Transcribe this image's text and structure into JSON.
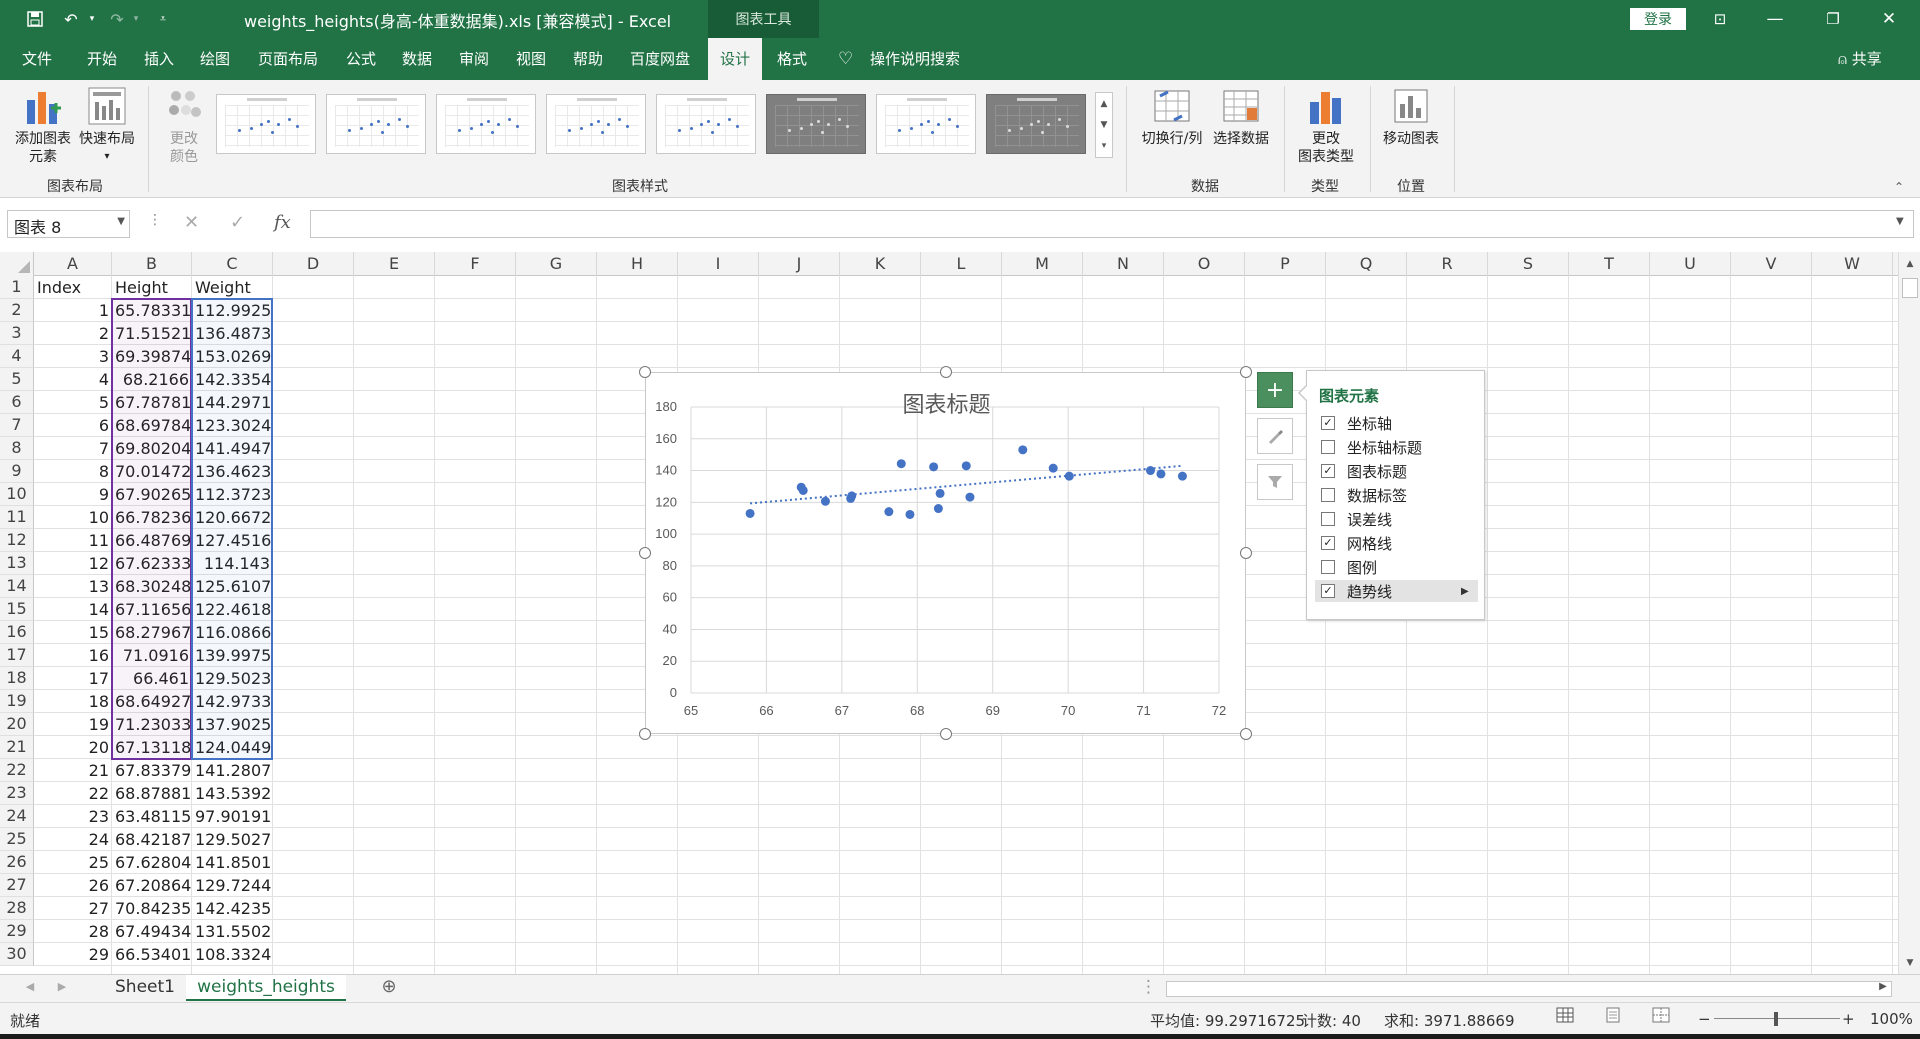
{
  "titlebar": {
    "doc_title": "weights_heights(身高-体重数据集).xls  [兼容模式]  -  Excel",
    "chart_tools": "图表工具",
    "login": "登录"
  },
  "menu": {
    "items": [
      "文件",
      "开始",
      "插入",
      "绘图",
      "页面布局",
      "公式",
      "数据",
      "审阅",
      "视图",
      "帮助",
      "百度网盘",
      "设计",
      "格式"
    ],
    "active": "设计",
    "search": "操作说明搜索",
    "share": "共享"
  },
  "ribbon": {
    "add_element": "添加图表",
    "add_element_2": "元素",
    "quick_layout": "快速布局",
    "change_color": "更改",
    "change_color_2": "颜色",
    "group_layout": "图表布局",
    "group_styles": "图表样式",
    "switch_rowcol": "切换行/列",
    "select_data": "选择数据",
    "group_data": "数据",
    "change_type": "更改",
    "change_type_2": "图表类型",
    "group_type": "类型",
    "move_chart": "移动图表",
    "group_location": "位置"
  },
  "formula_bar": {
    "name_box": "图表 8",
    "fx": "fx",
    "value": ""
  },
  "columns": [
    "A",
    "B",
    "C",
    "D",
    "E",
    "F",
    "G",
    "H",
    "I",
    "J",
    "K",
    "L",
    "M",
    "N",
    "O",
    "P",
    "Q",
    "R",
    "S",
    "T",
    "U",
    "V",
    "W"
  ],
  "headers": [
    "Index",
    "Height",
    "Weight"
  ],
  "rows": [
    [
      1,
      "65.78331",
      "112.9925"
    ],
    [
      2,
      "71.51521",
      "136.4873"
    ],
    [
      3,
      "69.39874",
      "153.0269"
    ],
    [
      4,
      "68.2166",
      "142.3354"
    ],
    [
      5,
      "67.78781",
      "144.2971"
    ],
    [
      6,
      "68.69784",
      "123.3024"
    ],
    [
      7,
      "69.80204",
      "141.4947"
    ],
    [
      8,
      "70.01472",
      "136.4623"
    ],
    [
      9,
      "67.90265",
      "112.3723"
    ],
    [
      10,
      "66.78236",
      "120.6672"
    ],
    [
      11,
      "66.48769",
      "127.4516"
    ],
    [
      12,
      "67.62333",
      "114.143"
    ],
    [
      13,
      "68.30248",
      "125.6107"
    ],
    [
      14,
      "67.11656",
      "122.4618"
    ],
    [
      15,
      "68.27967",
      "116.0866"
    ],
    [
      16,
      "71.0916",
      "139.9975"
    ],
    [
      17,
      "66.461",
      "129.5023"
    ],
    [
      18,
      "68.64927",
      "142.9733"
    ],
    [
      19,
      "71.23033",
      "137.9025"
    ],
    [
      20,
      "67.13118",
      "124.0449"
    ],
    [
      21,
      "67.83379",
      "141.2807"
    ],
    [
      22,
      "68.87881",
      "143.5392"
    ],
    [
      23,
      "63.48115",
      "97.90191"
    ],
    [
      24,
      "68.42187",
      "129.5027"
    ],
    [
      25,
      "67.62804",
      "141.8501"
    ],
    [
      26,
      "67.20864",
      "129.7244"
    ],
    [
      27,
      "70.84235",
      "142.4235"
    ],
    [
      28,
      "67.49434",
      "131.5502"
    ],
    [
      29,
      "66.53401",
      "108.3324"
    ]
  ],
  "chart_data": {
    "type": "scatter",
    "title": "图表标题",
    "xlim": [
      65,
      72
    ],
    "ylim": [
      0,
      180
    ],
    "xticks": [
      "65",
      "66",
      "67",
      "68",
      "69",
      "70",
      "71",
      "72"
    ],
    "yticks": [
      "0",
      "20",
      "40",
      "60",
      "80",
      "100",
      "120",
      "140",
      "160",
      "180"
    ],
    "grid": true,
    "legend": false,
    "trendline": "linear",
    "accent": "#4472c4",
    "points": [
      [
        65.78331,
        112.9925
      ],
      [
        71.51521,
        136.4873
      ],
      [
        69.39874,
        153.0269
      ],
      [
        68.2166,
        142.3354
      ],
      [
        67.78781,
        144.2971
      ],
      [
        68.69784,
        123.3024
      ],
      [
        69.80204,
        141.4947
      ],
      [
        70.01472,
        136.4623
      ],
      [
        67.90265,
        112.3723
      ],
      [
        66.78236,
        120.6672
      ],
      [
        66.48769,
        127.4516
      ],
      [
        67.62333,
        114.143
      ],
      [
        68.30248,
        125.6107
      ],
      [
        67.11656,
        122.4618
      ],
      [
        68.27967,
        116.0866
      ],
      [
        71.0916,
        139.9975
      ],
      [
        66.461,
        129.5023
      ],
      [
        68.64927,
        142.9733
      ],
      [
        71.23033,
        137.9025
      ],
      [
        67.13118,
        124.0449
      ]
    ]
  },
  "elements_panel": {
    "title": "图表元素",
    "items": [
      {
        "label": "坐标轴",
        "checked": true
      },
      {
        "label": "坐标轴标题",
        "checked": false
      },
      {
        "label": "图表标题",
        "checked": true
      },
      {
        "label": "数据标签",
        "checked": false
      },
      {
        "label": "误差线",
        "checked": false
      },
      {
        "label": "网格线",
        "checked": true
      },
      {
        "label": "图例",
        "checked": false
      },
      {
        "label": "趋势线",
        "checked": true
      }
    ]
  },
  "sheets": [
    "Sheet1",
    "weights_heights"
  ],
  "status": {
    "ready": "就绪",
    "average": "平均值: 99.29716725",
    "count": "计数: 40",
    "sum": "求和: 3971.88669",
    "zoom": "100%"
  }
}
